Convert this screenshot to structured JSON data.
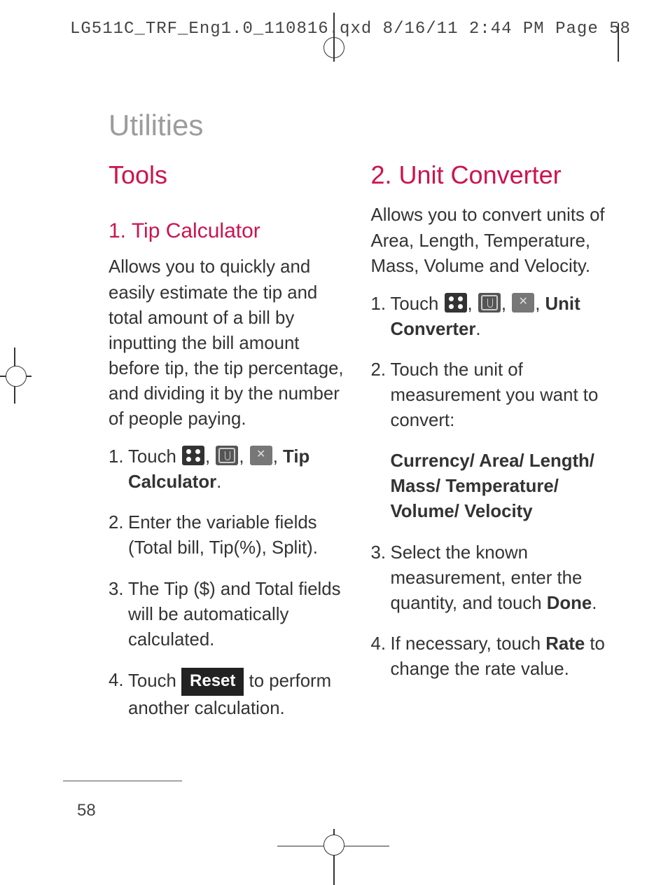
{
  "header": "LG511C_TRF_Eng1.0_110816.qxd  8/16/11  2:44 PM  Page 58",
  "page_title": "Utilities",
  "page_number": "58",
  "left": {
    "h1": "Tools",
    "h2": "1. Tip Calculator",
    "intro": "Allows you to quickly and easily estimate the tip and total amount of a bill by inputting the bill amount before tip, the tip percentage, and dividing it by the number of people paying.",
    "s1_pre": "Touch ",
    "s1_end": "Tip Calculator",
    "s1_dot": ".",
    "s2": "Enter the variable fields (Total bill, Tip(%), Split).",
    "s3": "The Tip ($) and Total fields will be automatically calculated.",
    "s4_pre": "Touch ",
    "s4_btn": "Reset",
    "s4_post": " to perform another calculation."
  },
  "right": {
    "h2": "2. Unit Converter",
    "intro": "Allows you to convert units of Area, Length, Temperature, Mass, Volume and Velocity.",
    "s1_pre": "Touch ",
    "s1_end": "Unit Converter",
    "s1_dot": ".",
    "s2": "Touch the unit of measurement you want to convert:",
    "s2_list": "Currency/ Area/ Length/ Mass/ Temperature/ Volume/ Velocity",
    "s3_pre": "Select the known measurement, enter the quantity, and touch ",
    "s3_bold": "Done",
    "s3_post": ".",
    "s4_pre": "If necessary, touch ",
    "s4_bold": "Rate",
    "s4_post": " to change the rate value."
  },
  "nums": {
    "n1": "1.",
    "n2": "2.",
    "n3": "3.",
    "n4": "4."
  },
  "sep": ", "
}
